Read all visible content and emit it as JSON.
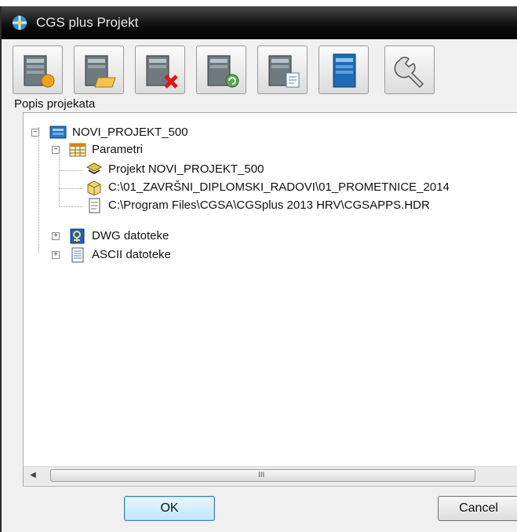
{
  "window": {
    "title": "CGS plus Projekt"
  },
  "toolbar": {
    "buttons": [
      {
        "icon": "server-new-icon"
      },
      {
        "icon": "server-open-icon"
      },
      {
        "icon": "server-delete-icon"
      },
      {
        "icon": "server-refresh-icon"
      },
      {
        "icon": "server-document-icon"
      },
      {
        "icon": "server-blue-icon"
      },
      {
        "icon": "wrench-icon"
      }
    ]
  },
  "tree": {
    "caption": "Popis projekata",
    "nodes": [
      {
        "label": "NOVI_PROJEKT_500",
        "icon": "project-server-icon",
        "expanded": true
      },
      {
        "label": "Parametri",
        "icon": "parameters-grid-icon",
        "expanded": true
      },
      {
        "label": "Projekt  NOVI_PROJEKT_500",
        "icon": "project-tool-icon"
      },
      {
        "label": "C:\\01_ZAVRŠNI_DIPLOMSKI_RADOVI\\01_PROMETNICE_2014",
        "icon": "folder-path-icon"
      },
      {
        "label": "C:\\Program Files\\CGSA\\CGSplus 2013 HRV\\CGSAPPS.HDR",
        "icon": "file-icon"
      },
      {
        "label": "DWG datoteke",
        "icon": "dwg-files-icon",
        "expanded": false
      },
      {
        "label": "ASCII datoteke",
        "icon": "ascii-files-icon",
        "expanded": false
      }
    ]
  },
  "scrollbar": {
    "grip": "III"
  },
  "dialog": {
    "ok": "OK",
    "cancel": "Cancel"
  },
  "colors": {
    "titlebar": "#101010",
    "ok_border": "#3c7fb1",
    "tree_bg": "#ffffff"
  }
}
